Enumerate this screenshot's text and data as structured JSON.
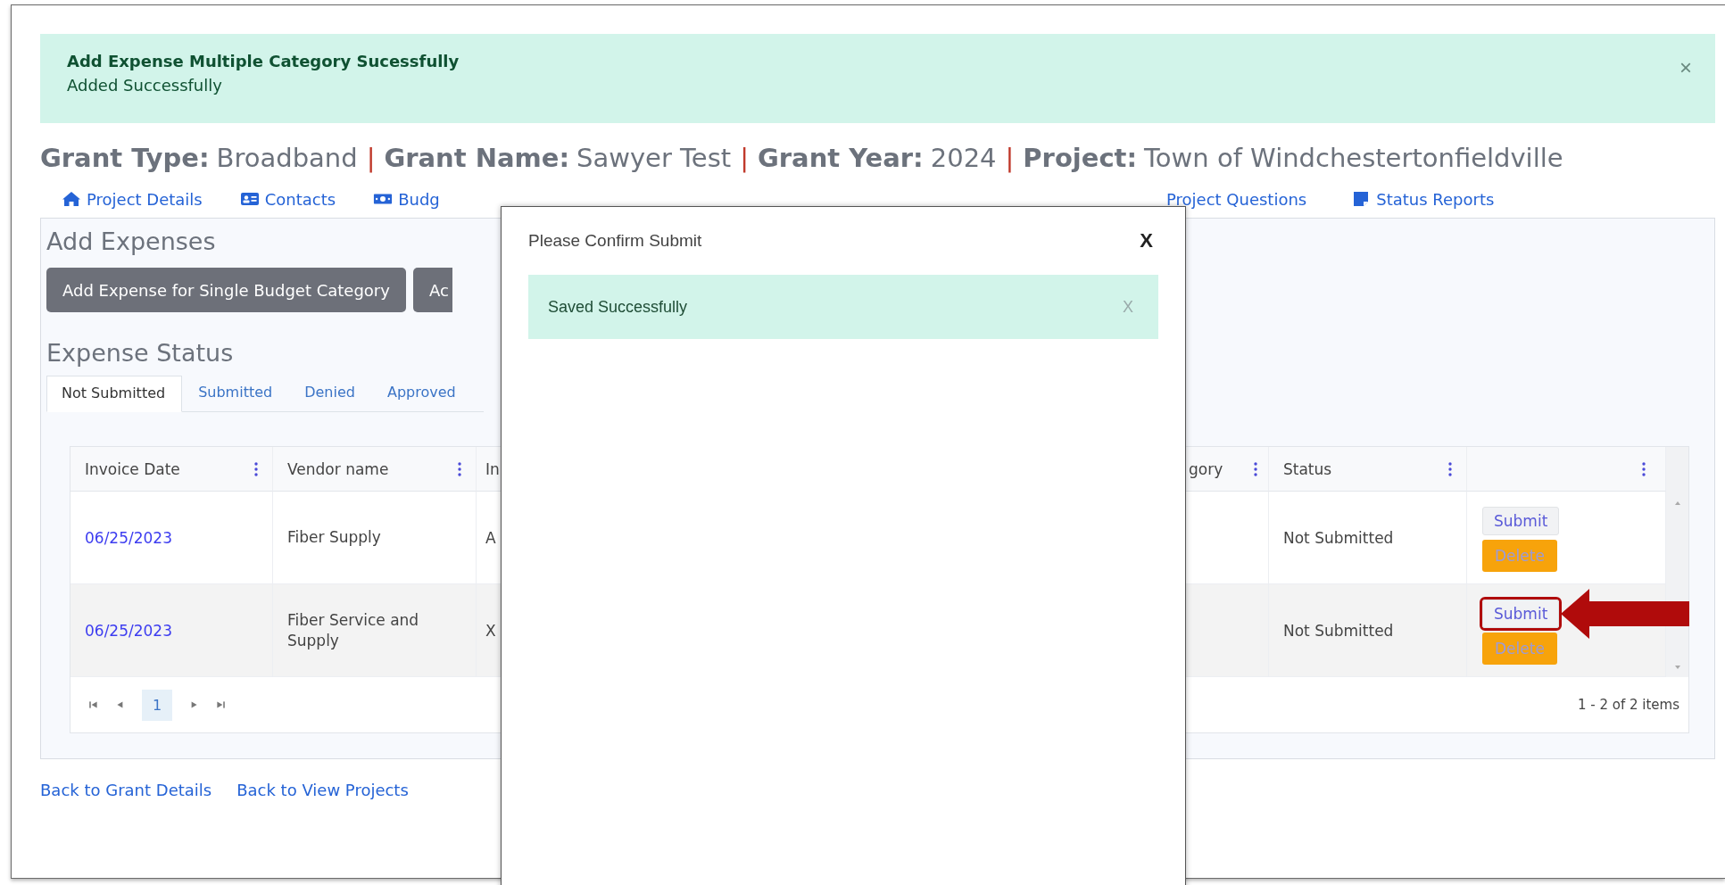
{
  "alert": {
    "title": "Add Expense Multiple Category Sucessfully",
    "message": "Added Successfully",
    "close": "×"
  },
  "heading": [
    {
      "label": "Grant Type:",
      "value": "Broadband"
    },
    {
      "separator": "|",
      "label": "Grant Name:",
      "value": "Sawyer Test"
    },
    {
      "separator": "|",
      "label": "Grant Year:",
      "value": "2024"
    },
    {
      "separator": "|",
      "label": "Project:",
      "value": "Town of Windchestertonfieldville"
    }
  ],
  "nav_tabs_left": [
    "Project Details",
    "Contacts",
    "Budg"
  ],
  "nav_tabs_right": [
    "Project Questions",
    "Status Reports"
  ],
  "add_expenses": {
    "title": "Add Expenses",
    "buttons": [
      "Add Expense for Single Budget Category",
      "Ac"
    ]
  },
  "expense_status": {
    "title": "Expense Status",
    "tabs": [
      {
        "label": "Not Submitted",
        "selected": true
      },
      {
        "label": "Submitted",
        "selected": false
      },
      {
        "label": "Denied",
        "selected": false
      },
      {
        "label": "Approved",
        "selected": false
      }
    ],
    "table": {
      "columns": [
        "Invoice Date",
        "Vendor name",
        "In",
        "gory",
        "Status"
      ],
      "rows": [
        {
          "invoice_date": "06/25/2023",
          "vendor_name": "Fiber Supply",
          "column_3": "A",
          "status": "Not Submitted",
          "actions": [
            "Submit",
            "Delete"
          ],
          "callout": false
        },
        {
          "invoice_date": "06/25/2023",
          "vendor_name": "Fiber Service and Supply",
          "column_3": "X",
          "status": "Not Submitted",
          "actions": [
            "Submit",
            "Delete"
          ],
          "callout": true
        }
      ],
      "pager": {
        "pages": [
          {
            "label": "1",
            "selected": true
          }
        ],
        "summary": "1 - 2 of 2 items"
      }
    }
  },
  "links": [
    "Back to Grant Details",
    "Back to View Projects"
  ],
  "modal": {
    "title": "Please Confirm Submit",
    "close": "X",
    "alert": {
      "message": "Saved Successfully",
      "close": "X"
    }
  }
}
